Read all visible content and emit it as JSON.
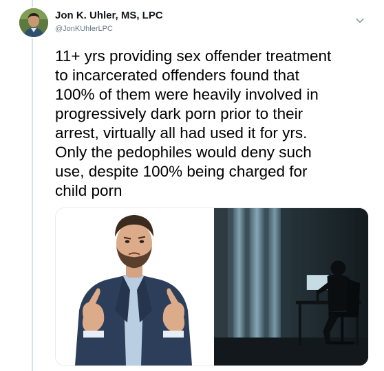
{
  "tweet": {
    "author": {
      "display_name": "Jon K. Uhler, MS, LPC",
      "handle": "@JonKUhlerLPC",
      "avatar_icon": "profile-photo"
    },
    "menu_icon": "chevron-down-icon",
    "text": "11+ yrs providing sex offender treatment\nto incarcerated offenders found that\n100% of them were heavily involved in\nprogressively dark porn prior to their\narrest, virtually all had used it for yrs.\nOnly the pedophiles would deny such\nuse, despite 100% being charged for\nchild porn",
    "media": [
      {
        "kind": "photo",
        "subject": "man-pointing-at-himself"
      },
      {
        "kind": "photo",
        "subject": "person-at-computer-in-dark-room"
      }
    ]
  },
  "colors": {
    "thread_line": "#cfe3f3",
    "handle_text": "#657786",
    "body_text": "#000000"
  }
}
